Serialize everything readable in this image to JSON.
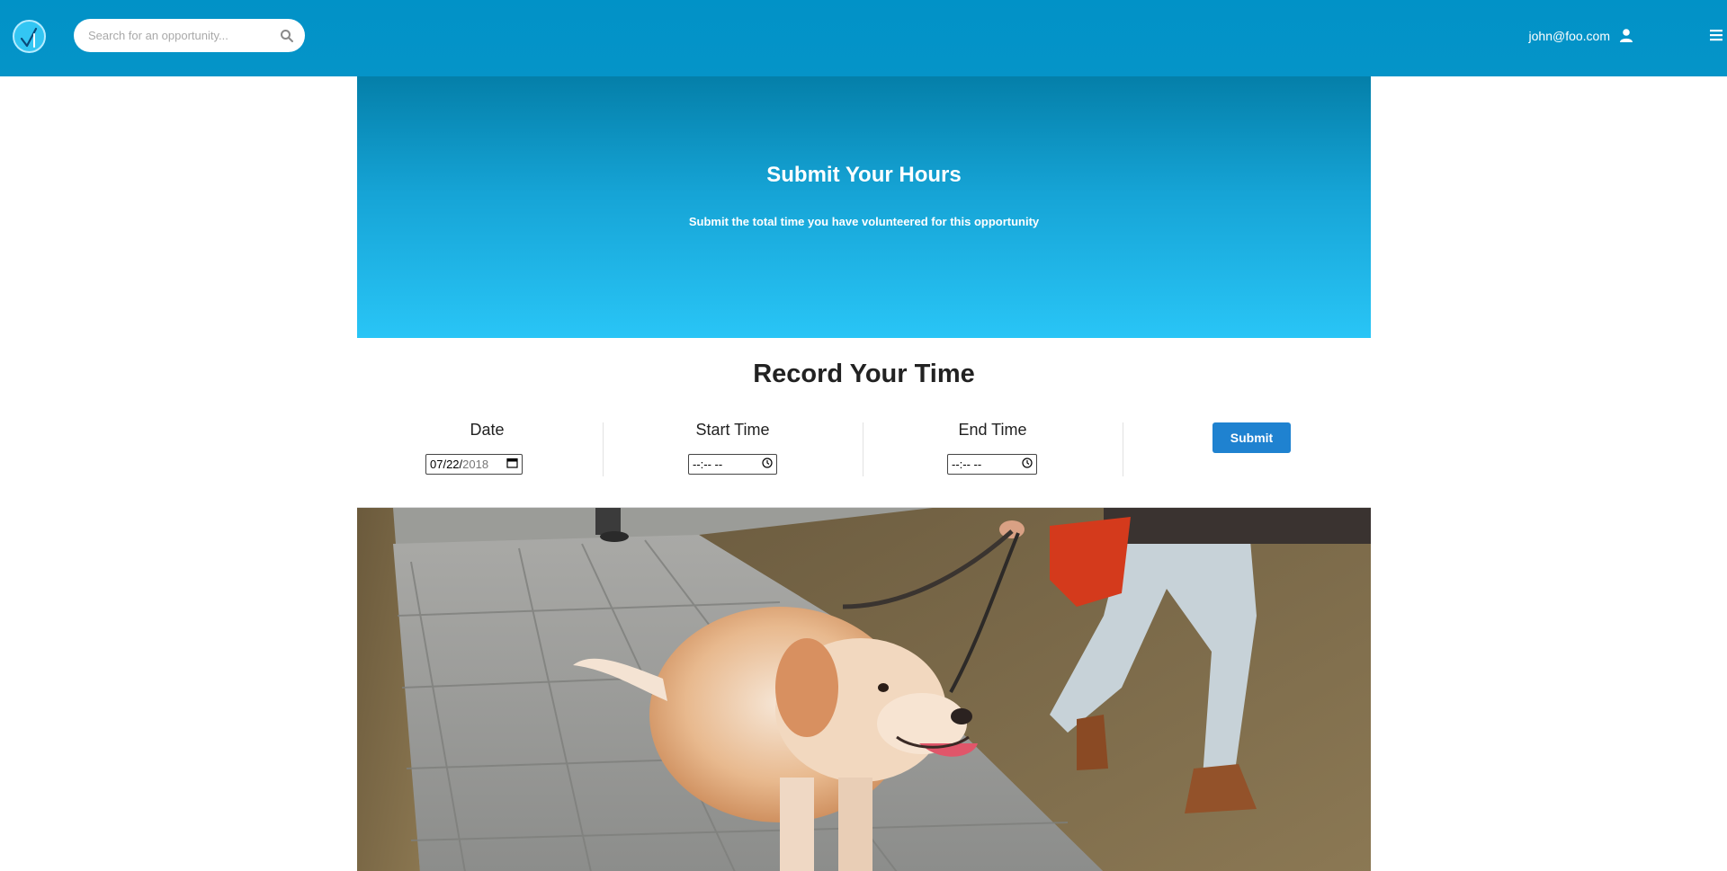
{
  "header": {
    "logo_icon": "checkmark-logo-icon",
    "search": {
      "placeholder": "Search for an opportunity..."
    },
    "user_email": "john@foo.com",
    "user_icon": "user-icon",
    "menu_icon": "hamburger-menu-icon"
  },
  "hero": {
    "title": "Submit Your Hours",
    "subtitle": "Submit the total time you have volunteered for this opportunity"
  },
  "record": {
    "title": "Record Your Time",
    "date_label": "Date",
    "date_value_month_day": "07/22/",
    "date_value_year": "2018",
    "start_label": "Start Time",
    "start_value": "--:-- --",
    "end_label": "End Time",
    "end_value": "--:-- --",
    "submit_label": "Submit"
  },
  "colors": {
    "navbar": "#0192c7",
    "hero_top": "#047fa9",
    "hero_bottom": "#29c5f6",
    "submit": "#1f82d0"
  }
}
